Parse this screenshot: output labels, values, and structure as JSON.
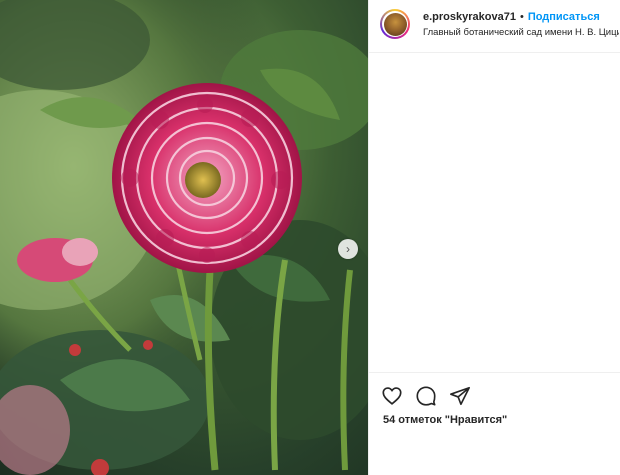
{
  "post": {
    "username": "e.proskyrakova71",
    "separator": "•",
    "follow_label": "Подписаться",
    "location": "Главный ботанический сад имени Н. В. Цицина",
    "likes_text": "54 отметок \"Нравится\""
  },
  "icons": {
    "like": "heart-icon",
    "comment": "comment-icon",
    "share": "send-icon",
    "next": "chevron-right-icon"
  },
  "colors": {
    "accent": "#0095f6",
    "flower": "#d8306a"
  }
}
